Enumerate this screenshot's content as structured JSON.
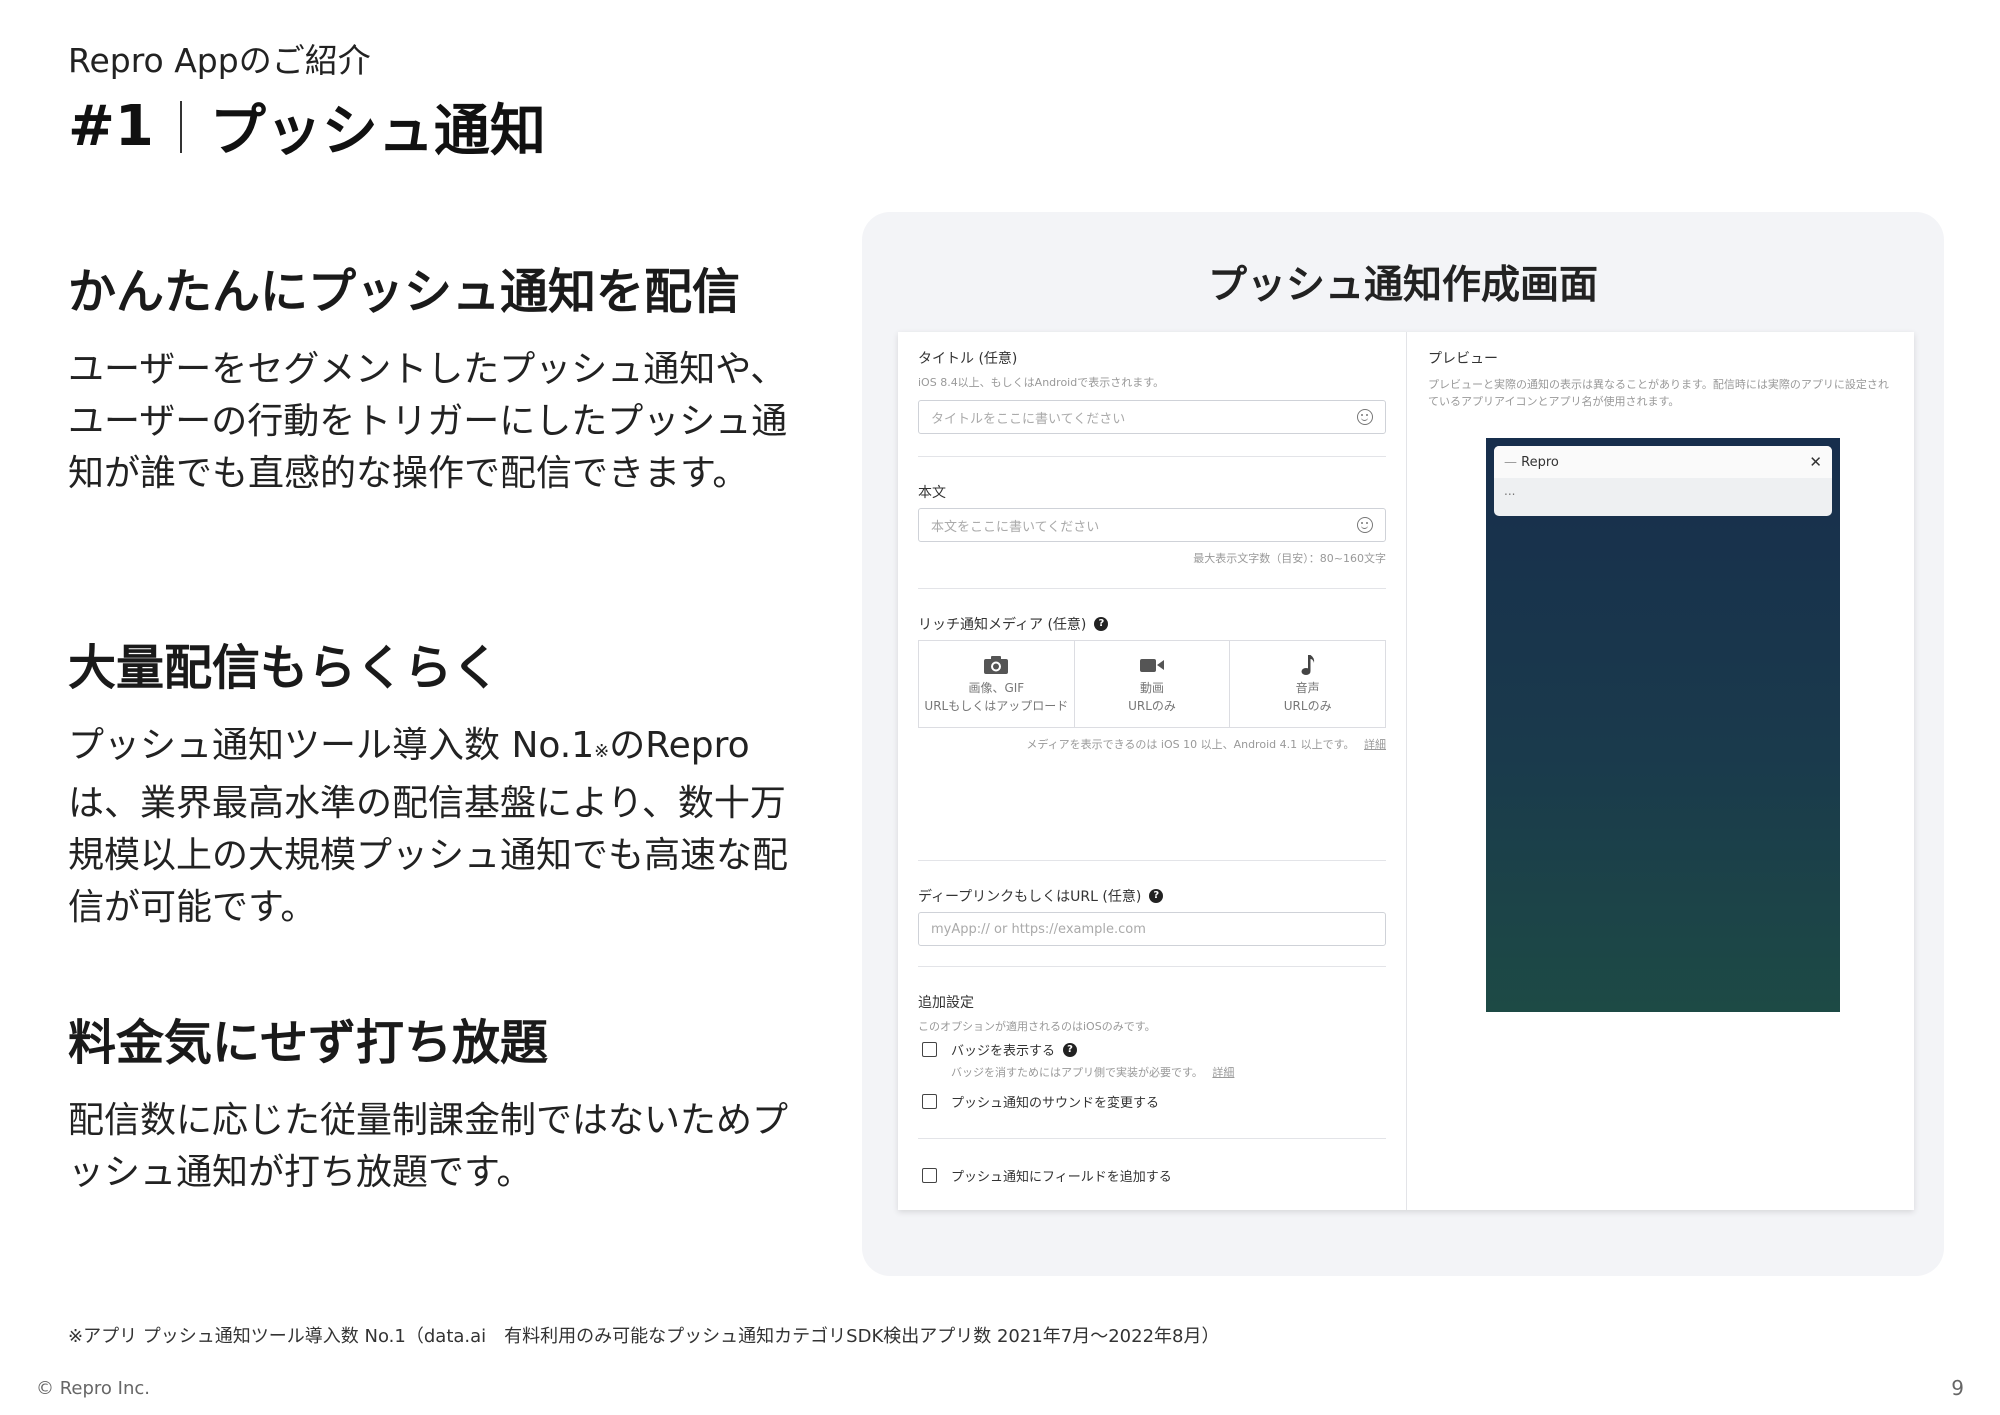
{
  "header": {
    "subtitle": "Repro Appのご紹介",
    "number": "#1",
    "title": "プッシュ通知"
  },
  "sections": [
    {
      "heading": "かんたんにプッシュ通知を配信",
      "body": "ユーザーをセグメントしたプッシュ通知や、ユーザーの行動をトリガーにしたプッシュ通知が誰でも直感的な操作で配信できます。"
    },
    {
      "heading": "大量配信もらくらく",
      "body_pre": "プッシュ通知ツール導入数 No.1",
      "body_note": "※",
      "body_post": "のReproは、業界最高水準の配信基盤により、数十万規模以上の大規模プッシュ通知でも高速な配信が可能です。"
    },
    {
      "heading": "料金気にせず打ち放題",
      "body": "配信数に応じた従量制課金制ではないためプッシュ通知が打ち放題です。"
    }
  ],
  "panel": {
    "title": "プッシュ通知作成画面",
    "form": {
      "title_label": "タイトル (任意)",
      "title_hint": "iOS 8.4以上、もしくはAndroidで表示されます。",
      "title_placeholder": "タイトルをここに書いてください",
      "body_label": "本文",
      "body_placeholder": "本文をここに書いてください",
      "body_counter": "最大表示文字数（目安）：80~160文字",
      "media_label": "リッチ通知メディア (任意)",
      "help_glyph": "?",
      "media_items": [
        {
          "icon": "camera-icon",
          "name": "画像、GIF",
          "sub": "URLもしくはアップロード"
        },
        {
          "icon": "video-icon",
          "name": "動画",
          "sub": "URLのみ"
        },
        {
          "icon": "music-note-icon",
          "name": "音声",
          "sub": "URLのみ"
        }
      ],
      "media_note": "メディアを表示できるのは iOS 10 以上、Android 4.1 以上です。",
      "detail_link": "詳細",
      "deeplink_label": "ディープリンクもしくはURL (任意)",
      "deeplink_placeholder": "myApp:// or https://example.com",
      "extra_label": "追加設定",
      "extra_hint": "このオプションが適用されるのはiOSのみです。",
      "badge_label": "バッジを表示する",
      "badge_hint": "バッジを消すためにはアプリ側で実装が必要です。",
      "sound_label": "プッシュ通知のサウンドを変更する",
      "field_label": "プッシュ通知にフィールドを追加する"
    },
    "preview": {
      "label": "プレビュー",
      "hint": "プレビューと実際の通知の表示は異なることがあります。配信時には実際のアプリに設定されているアプリアイコンとアプリ名が使用されます。",
      "app_name": "Repro",
      "close_glyph": "✕",
      "body": "..."
    }
  },
  "footnote": "※アプリ プッシュ通知ツール導入数 No.1（data.ai　有料利用のみ可能なプッシュ通知カテゴリSDK検出アプリ数 2021年7月〜2022年8月）",
  "copyright": "© Repro Inc.",
  "page_number": "9"
}
